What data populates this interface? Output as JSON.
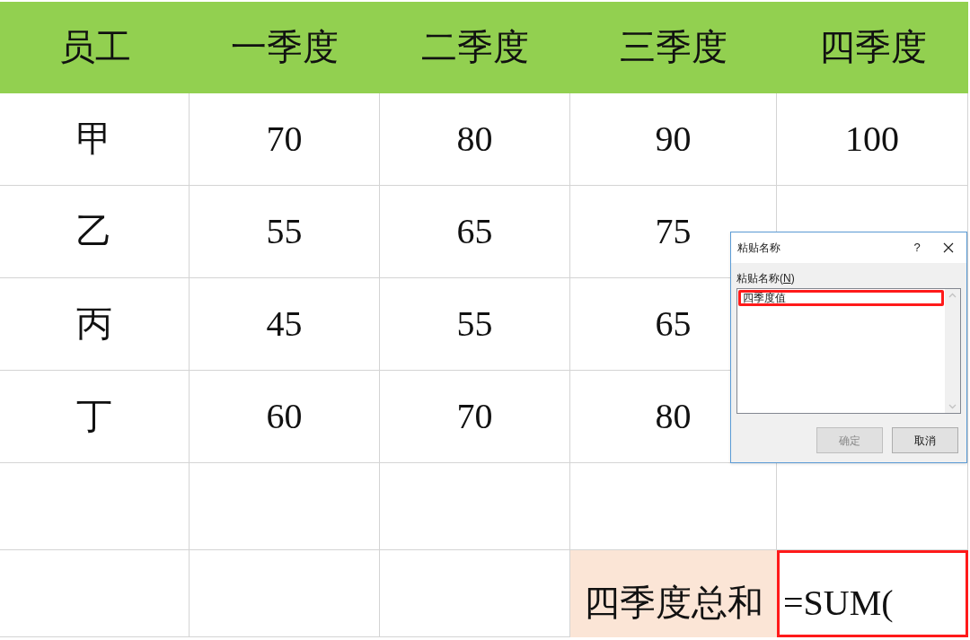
{
  "sheet": {
    "columns": [
      "员工",
      "一季度",
      "二季度",
      "三季度",
      "四季度"
    ],
    "rows": [
      [
        "甲",
        "70",
        "80",
        "90",
        "100"
      ],
      [
        "乙",
        "55",
        "65",
        "75"
      ],
      [
        "丙",
        "45",
        "55",
        "65"
      ],
      [
        "丁",
        "60",
        "70",
        "80"
      ]
    ],
    "summary": {
      "label": "四季度总和",
      "formula": "=SUM("
    }
  },
  "dialog": {
    "title": "粘贴名称",
    "help": "?",
    "label_parts": [
      "粘贴名称(",
      "N",
      ")"
    ],
    "items": [
      {
        "text": "四季度值",
        "selected": true
      }
    ],
    "buttons": [
      {
        "label": "确定",
        "disabled": true
      },
      {
        "label": "取消",
        "disabled": false
      }
    ]
  }
}
